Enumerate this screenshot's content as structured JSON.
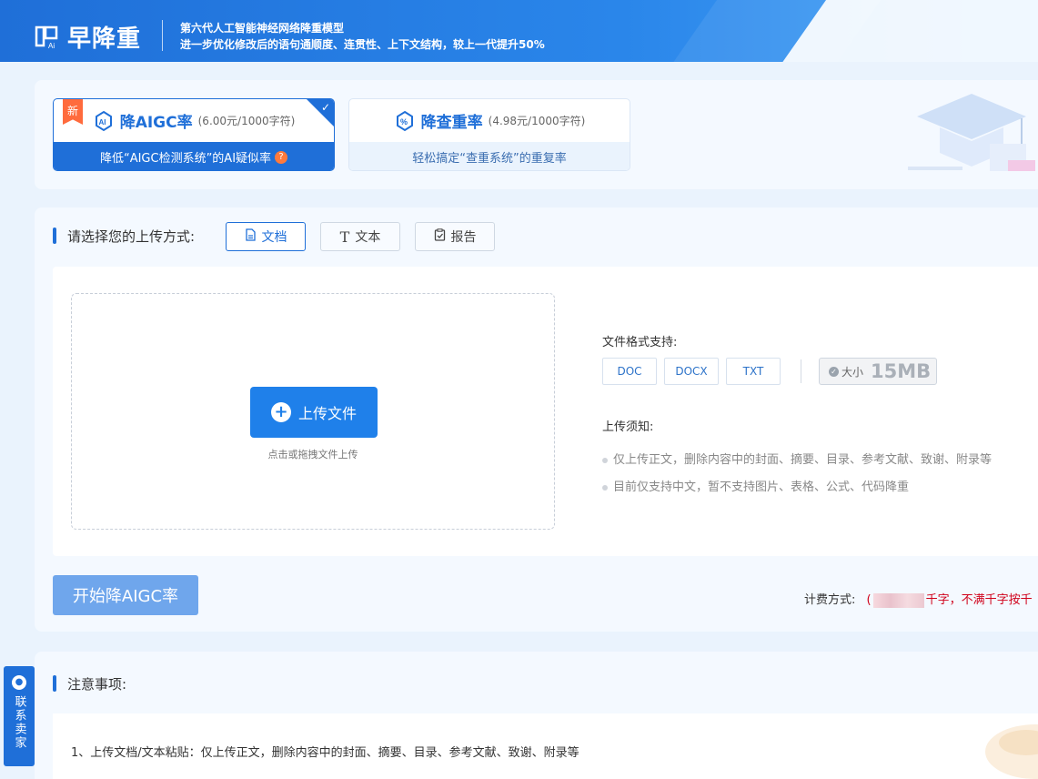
{
  "header": {
    "logo_text": "早降重",
    "tagline1": "第六代人工智能神经网络降重模型",
    "tagline2": "进一步优化修改后的语句通顺度、连贯性、上下文结构，较上一代提升50%"
  },
  "modes": [
    {
      "title": "降AIGC率",
      "price": "(6.00元/1000字符)",
      "desc": "降低“AIGC检测系统”的AI疑似率",
      "badge": "新",
      "active": true,
      "icon": "ai-shield-icon"
    },
    {
      "title": "降查重率",
      "price": "(4.98元/1000字符)",
      "desc": "轻松搞定“查重系统”的重复率",
      "active": false,
      "icon": "percent-shield-icon"
    }
  ],
  "upload": {
    "section_label": "请选择您的上传方式:",
    "tabs": [
      {
        "label": "文档",
        "icon": "document-icon",
        "selected": true
      },
      {
        "label": "文本",
        "icon": "text-icon",
        "selected": false
      },
      {
        "label": "报告",
        "icon": "report-icon",
        "selected": false
      }
    ],
    "button_label": "上传文件",
    "hint": "点击或拖拽文件上传",
    "format_label": "文件格式支持:",
    "formats": [
      "DOC",
      "DOCX",
      "TXT"
    ],
    "size_label": "大小",
    "size_value": "15MB",
    "notice_label": "上传须知:",
    "notices": [
      "仅上传正文，删除内容中的封面、摘要、目录、参考文献、致谢、附录等",
      "目前仅支持中文，暂不支持图片、表格、公式、代码降重"
    ]
  },
  "action": {
    "start_label": "开始降AIGC率",
    "billing_label": "计费方式:",
    "billing_prefix": "(",
    "billing_suffix": "千字，不满千字按千"
  },
  "notes": {
    "title": "注意事项:",
    "line1": "1、上传文档/文本粘贴：仅上传正文，删除内容中的封面、摘要、目录、参考文献、致谢、附录等"
  },
  "contact": {
    "label": "联系卖家"
  },
  "colors": {
    "primary": "#1f6fd8",
    "start_button": "#6fa6ec",
    "new_badge": "#ff6b3d",
    "billing_red": "#d0021b"
  }
}
